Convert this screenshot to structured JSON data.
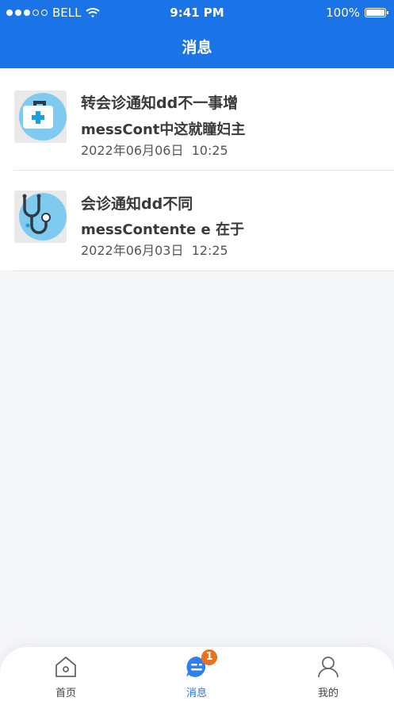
{
  "status_bar": {
    "carrier": "BELL",
    "time": "9:41 PM",
    "battery": "100%"
  },
  "header": {
    "title": "消息"
  },
  "messages": [
    {
      "title": "转会诊通知dd不一事增",
      "content": "messCont中这就瞳妇主",
      "time": "2022年06月06日  10:25",
      "icon": "medical-kit-icon"
    },
    {
      "title": "会诊通知dd不同",
      "content": "messContente e 在于",
      "time": "2022年06月03日  12:25",
      "icon": "stethoscope-icon"
    }
  ],
  "tabbar": {
    "tabs": [
      {
        "label": "首页",
        "icon": "home-icon"
      },
      {
        "label": "消息",
        "icon": "message-icon",
        "badge": "1",
        "active": true
      },
      {
        "label": "我的",
        "icon": "profile-icon"
      }
    ]
  },
  "colors": {
    "primary": "#1b73e8",
    "badge": "#e8711f",
    "icon_light_blue": "#7ecbef"
  }
}
